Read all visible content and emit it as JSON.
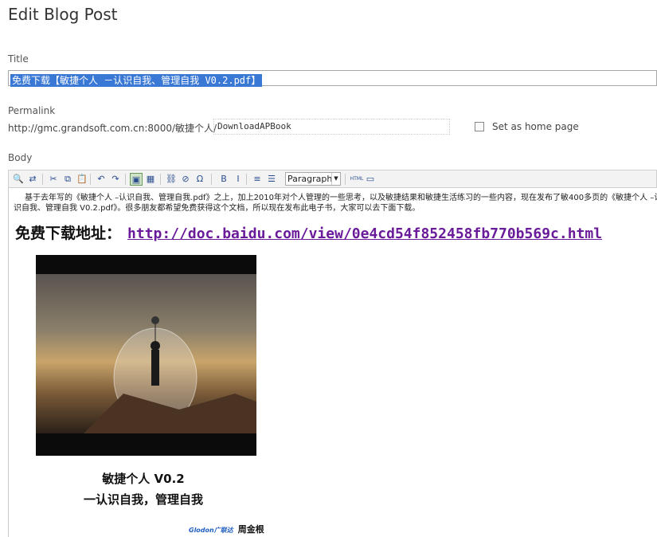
{
  "page": {
    "title": "Edit Blog Post"
  },
  "form": {
    "title_label": "Title",
    "title_value": "免费下载【敏捷个人 －认识自我、管理自我 V0.2.pdf】",
    "permalink_label": "Permalink",
    "permalink_base": "http://gmc.grandsoft.com.cn:8000/敏捷个人/",
    "permalink_value": "DownloadAPBook",
    "home_label": "Set as home page",
    "body_label": "Body"
  },
  "toolbar": {
    "format_value": "Paragraph",
    "buttons": [
      {
        "name": "find-icon",
        "glyph": "🔍"
      },
      {
        "name": "replace-icon",
        "glyph": "⇄"
      },
      {
        "name": "cut-icon",
        "glyph": "✂"
      },
      {
        "name": "copy-icon",
        "glyph": "⧉"
      },
      {
        "name": "paste-icon",
        "glyph": "📋"
      },
      {
        "name": "undo-icon",
        "glyph": "↶"
      },
      {
        "name": "redo-icon",
        "glyph": "↷"
      },
      {
        "name": "image-icon",
        "glyph": "▣"
      },
      {
        "name": "media-icon",
        "glyph": "▦"
      },
      {
        "name": "link-icon",
        "glyph": "⛓"
      },
      {
        "name": "unlink-icon",
        "glyph": "⊘"
      },
      {
        "name": "special-char-icon",
        "glyph": "Ω"
      },
      {
        "name": "bold-icon",
        "glyph": "B"
      },
      {
        "name": "italic-icon",
        "glyph": "I"
      },
      {
        "name": "ordered-list-icon",
        "glyph": "≡"
      },
      {
        "name": "unordered-list-icon",
        "glyph": "☰"
      },
      {
        "name": "html-icon",
        "glyph": "HTML"
      },
      {
        "name": "fullscreen-icon",
        "glyph": "▭"
      }
    ]
  },
  "body": {
    "intro": "基于去年写的《敏捷个人 –认识自我、管理自我.pdf》之上，加上2010年对个人管理的一些思考，以及敏捷结果和敏捷生活练习的一些内容，现在发布了敏400多页的《敏捷个人 –认识自我、管理自我 V0.2.pdf》。很多朋友都希望免费获得这个文档，所以现在发布此电子书，大家可以去下面下载。",
    "download_label": "免费下载地址：",
    "download_url": "http://doc.baidu.com/view/0e4cd54f852458fb770b569c.html",
    "book_title": "敏捷个人 V0.2",
    "book_subtitle": "一认识自我，管理自我",
    "publisher_logo": "Glodon广联达",
    "author": "周金根"
  }
}
